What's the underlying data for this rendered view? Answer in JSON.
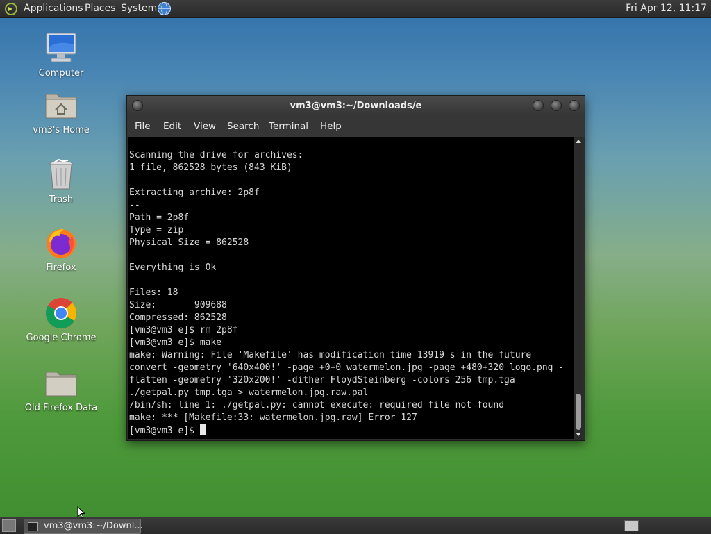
{
  "top_panel": {
    "menus": [
      "Applications",
      "Places",
      "System"
    ],
    "clock": "Fri Apr 12, 11:17"
  },
  "desktop_icons": [
    {
      "label": "Computer",
      "icon": "computer-icon"
    },
    {
      "label": "vm3's Home",
      "icon": "home-folder-icon"
    },
    {
      "label": "Trash",
      "icon": "trash-icon"
    },
    {
      "label": "Firefox",
      "icon": "firefox-icon"
    },
    {
      "label": "Google Chrome",
      "icon": "chrome-icon"
    },
    {
      "label": "Old Firefox Data",
      "icon": "folder-icon"
    }
  ],
  "window": {
    "title": "vm3@vm3:~/Downloads/e",
    "menus": [
      "File",
      "Edit",
      "View",
      "Search",
      "Terminal",
      "Help"
    ]
  },
  "terminal": {
    "lines": [
      "Scanning the drive for archives:",
      "1 file, 862528 bytes (843 KiB)",
      "",
      "Extracting archive: 2p8f",
      "--",
      "Path = 2p8f",
      "Type = zip",
      "Physical Size = 862528",
      "",
      "Everything is Ok",
      "",
      "Files: 18",
      "Size:       909688",
      "Compressed: 862528",
      "[vm3@vm3 e]$ rm 2p8f",
      "[vm3@vm3 e]$ make",
      "make: Warning: File 'Makefile' has modification time 13919 s in the future",
      "convert -geometry '640x400!' -page +0+0 watermelon.jpg -page +480+320 logo.png -",
      "flatten -geometry '320x200!' -dither FloydSteinberg -colors 256 tmp.tga",
      "./getpal.py tmp.tga > watermelon.jpg.raw.pal",
      "/bin/sh: line 1: ./getpal.py: cannot execute: required file not found",
      "make: *** [Makefile:33: watermelon.jpg.raw] Error 127"
    ],
    "prompt": "[vm3@vm3 e]$ "
  },
  "taskbar": {
    "task_label": "vm3@vm3:~/Downl..."
  }
}
